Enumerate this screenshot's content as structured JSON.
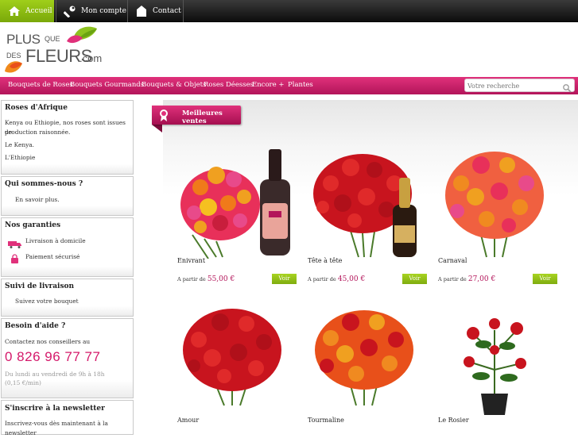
{
  "topbar": {
    "items": [
      {
        "label": "Accueil",
        "icon": "home-icon"
      },
      {
        "label": "Mon compte",
        "icon": "wrench-icon"
      },
      {
        "label": "Contact",
        "icon": "house-icon"
      }
    ]
  },
  "logo": {
    "line1": "PLUS",
    "que": "QUE",
    "des": "DES",
    "line2": "FLEURS",
    "com": ".com"
  },
  "nav": {
    "items": [
      "Bouquets de Roses",
      "Bouquets Gourmands",
      "Bouquets & Objets",
      "Roses Déesses",
      "Encore +",
      "Plantes"
    ]
  },
  "search": {
    "placeholder": "Votre recherche"
  },
  "sidebar": {
    "roses": {
      "title": "Roses d'Afrique",
      "text1": "Kenya ou Ethiopie, nos roses sont issues de",
      "text2": "production raisonnée.",
      "link1": "Le Kenya.",
      "link2": "L'Ethiopie"
    },
    "qui": {
      "title": "Qui sommes-nous ?",
      "link": "En savoir plus."
    },
    "garanties": {
      "title": "Nos garanties",
      "item1": "Livraison à domicile",
      "item2": "Paiement sécurisé"
    },
    "suivi": {
      "title": "Suivi de livraison",
      "link": "Suivez votre bouquet"
    },
    "aide": {
      "title": "Besoin d'aide ?",
      "text": "Contactez nos conseillers au",
      "phone": "0 826 96 77 77",
      "hours": "Du lundi au vendredi de 9h à 18h",
      "cost": "(0,15 €/min)"
    },
    "newsletter": {
      "title": "S'inscrire à la newsletter",
      "text1": "Inscrivez-vous dès maintenant à la",
      "text2": "newsletter"
    }
  },
  "main": {
    "section_title": "Meilleures ventes",
    "products": [
      {
        "name": "Enivrant",
        "price_prefix": "A partir de",
        "price": "55,00 €",
        "button": "Voir"
      },
      {
        "name": "Tête à tête",
        "price_prefix": "A partir de",
        "price": "45,00 €",
        "button": "Voir"
      },
      {
        "name": "Carnaval",
        "price_prefix": "A partir de",
        "price": "27,00 €",
        "button": "Voir"
      },
      {
        "name": "Amour"
      },
      {
        "name": "Tourmaline"
      },
      {
        "name": "Le Rosier"
      }
    ]
  },
  "colors": {
    "accent": "#d4196a",
    "green": "#8dbd14",
    "nav": "#c8206a"
  }
}
